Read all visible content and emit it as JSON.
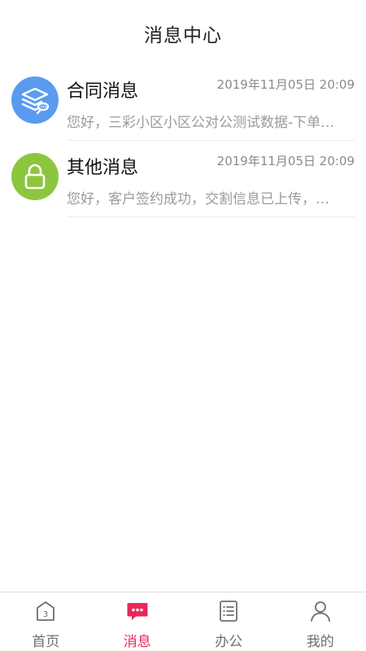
{
  "header": {
    "title": "消息中心"
  },
  "messages": [
    {
      "title": "合同消息",
      "time": "2019年11月05日 20:09",
      "preview": "您好，三彩小区小区公对公测试数据-下单…",
      "icon": "layers-icon",
      "icon_color": "#5a9bf0"
    },
    {
      "title": "其他消息",
      "time": "2019年11月05日 20:09",
      "preview": "您好，客户签约成功，交割信息已上传，…",
      "icon": "lock-icon",
      "icon_color": "#8cc63e"
    }
  ],
  "tabbar": {
    "active_color": "#e8285a",
    "inactive_color": "#6e6e6e",
    "tabs": [
      {
        "label": "首页",
        "icon": "home-icon",
        "active": false
      },
      {
        "label": "消息",
        "icon": "message-icon",
        "active": true
      },
      {
        "label": "办公",
        "icon": "document-icon",
        "active": false
      },
      {
        "label": "我的",
        "icon": "user-icon",
        "active": false
      }
    ]
  }
}
